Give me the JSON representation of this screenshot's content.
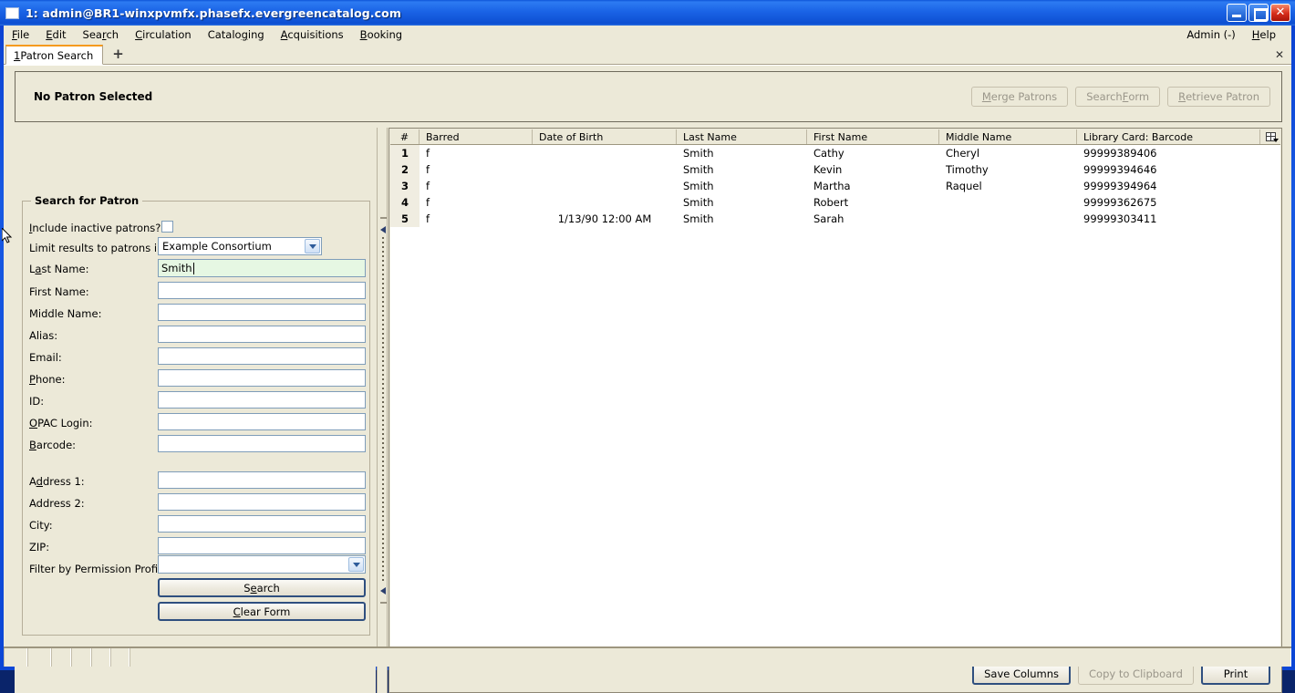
{
  "window": {
    "title": "1: admin@BR1-winxpvmfx.phasefx.evergreencatalog.com",
    "icon": "window-icon",
    "minimize": "minimize-icon",
    "maximize": "maximize-icon",
    "close": "close-icon"
  },
  "menubar": {
    "items": [
      {
        "label": "File",
        "accel": "F"
      },
      {
        "label": "Edit",
        "accel": "E"
      },
      {
        "label": "Search",
        "accel": "r"
      },
      {
        "label": "Circulation",
        "accel": "C"
      },
      {
        "label": "Cataloging",
        "accel": "g"
      },
      {
        "label": "Acquisitions",
        "accel": "A"
      },
      {
        "label": "Booking",
        "accel": "B"
      }
    ],
    "right": [
      {
        "label": "Admin (-)"
      },
      {
        "label": "Help",
        "accel": "H"
      }
    ]
  },
  "tabbar": {
    "tab_number": "1",
    "tab_label": " Patron Search",
    "new_tab": "+",
    "close_tab": "✕"
  },
  "patron_header": {
    "status": "No Patron Selected",
    "buttons": [
      {
        "label": "Merge Patrons",
        "accel_prefix": "M",
        "rest": "erge Patrons",
        "disabled": true
      },
      {
        "label": "Search Form",
        "pre": "Search ",
        "accel": "F",
        "post": "orm",
        "disabled": true
      },
      {
        "label": "Retrieve Patron",
        "accel_prefix": "R",
        "rest": "etrieve Patron",
        "disabled": true
      }
    ]
  },
  "search_form": {
    "caption": "Search for Patron",
    "fields": [
      {
        "name": "include-inactive",
        "label_pre": "I",
        "label_accel": "n",
        "label_post": "clude inactive patrons?",
        "label": "Include inactive patrons?",
        "type": "checkbox",
        "checked": false
      },
      {
        "name": "limit-results",
        "label": "Limit results to patrons in",
        "type": "select",
        "value": "Example Consortium"
      },
      {
        "name": "last-name",
        "label_pre": "L",
        "label_accel": "a",
        "label_post": "st Name:",
        "label": "Last Name:",
        "type": "text",
        "value": "Smith",
        "focused": true
      },
      {
        "name": "first-name",
        "label": "First Name:",
        "type": "text",
        "value": ""
      },
      {
        "name": "middle-name",
        "label": "Middle Name:",
        "type": "text",
        "value": ""
      },
      {
        "name": "alias",
        "label": "Alias:",
        "type": "text",
        "value": ""
      },
      {
        "name": "email",
        "label": "Email:",
        "type": "text",
        "value": ""
      },
      {
        "name": "phone",
        "label": "Phone:",
        "type": "text",
        "value": ""
      },
      {
        "name": "id",
        "label": "ID:",
        "type": "text",
        "value": ""
      },
      {
        "name": "opac-login",
        "label": "OPAC Login:",
        "type": "text",
        "value": ""
      },
      {
        "name": "barcode",
        "label": "Barcode:",
        "type": "text",
        "value": ""
      },
      {
        "name": "address-1",
        "label": "Address 1:",
        "type": "text",
        "value": ""
      },
      {
        "name": "address-2",
        "label": "Address 2:",
        "type": "text",
        "value": ""
      },
      {
        "name": "city",
        "label": "City:",
        "type": "text",
        "value": ""
      },
      {
        "name": "zip",
        "label": "ZIP:",
        "type": "text",
        "value": ""
      },
      {
        "name": "permission-profile",
        "label": "Filter by Permission Profile:",
        "type": "select",
        "value": ""
      }
    ],
    "search_button": "Search",
    "clear_button": "Clear Form"
  },
  "results": {
    "columns": [
      "#",
      "Barred",
      "Date of Birth",
      "Last Name",
      "First Name",
      "Middle Name",
      "Library Card: Barcode"
    ],
    "column_picker": "column-picker-icon",
    "rows": [
      {
        "num": "1",
        "barred": "f",
        "dob": "",
        "last": "Smith",
        "first": "Cathy",
        "middle": "Cheryl",
        "barcode": "99999389406"
      },
      {
        "num": "2",
        "barred": "f",
        "dob": "",
        "last": "Smith",
        "first": "Kevin",
        "middle": "Timothy",
        "barcode": "99999394646"
      },
      {
        "num": "3",
        "barred": "f",
        "dob": "",
        "last": "Smith",
        "first": "Martha",
        "middle": "Raquel",
        "barcode": "99999394964"
      },
      {
        "num": "4",
        "barred": "f",
        "dob": "",
        "last": "Smith",
        "first": "Robert",
        "middle": "",
        "barcode": "99999362675"
      },
      {
        "num": "5",
        "barred": "f",
        "dob": "1/13/90 12:00 AM",
        "last": "Smith",
        "first": "Sarah",
        "middle": "",
        "barcode": "99999303411"
      }
    ],
    "footer_buttons": [
      {
        "label": "Save Columns",
        "disabled": false
      },
      {
        "label": "Copy to Clipboard",
        "disabled": true
      },
      {
        "label": "Print",
        "disabled": false
      }
    ]
  }
}
